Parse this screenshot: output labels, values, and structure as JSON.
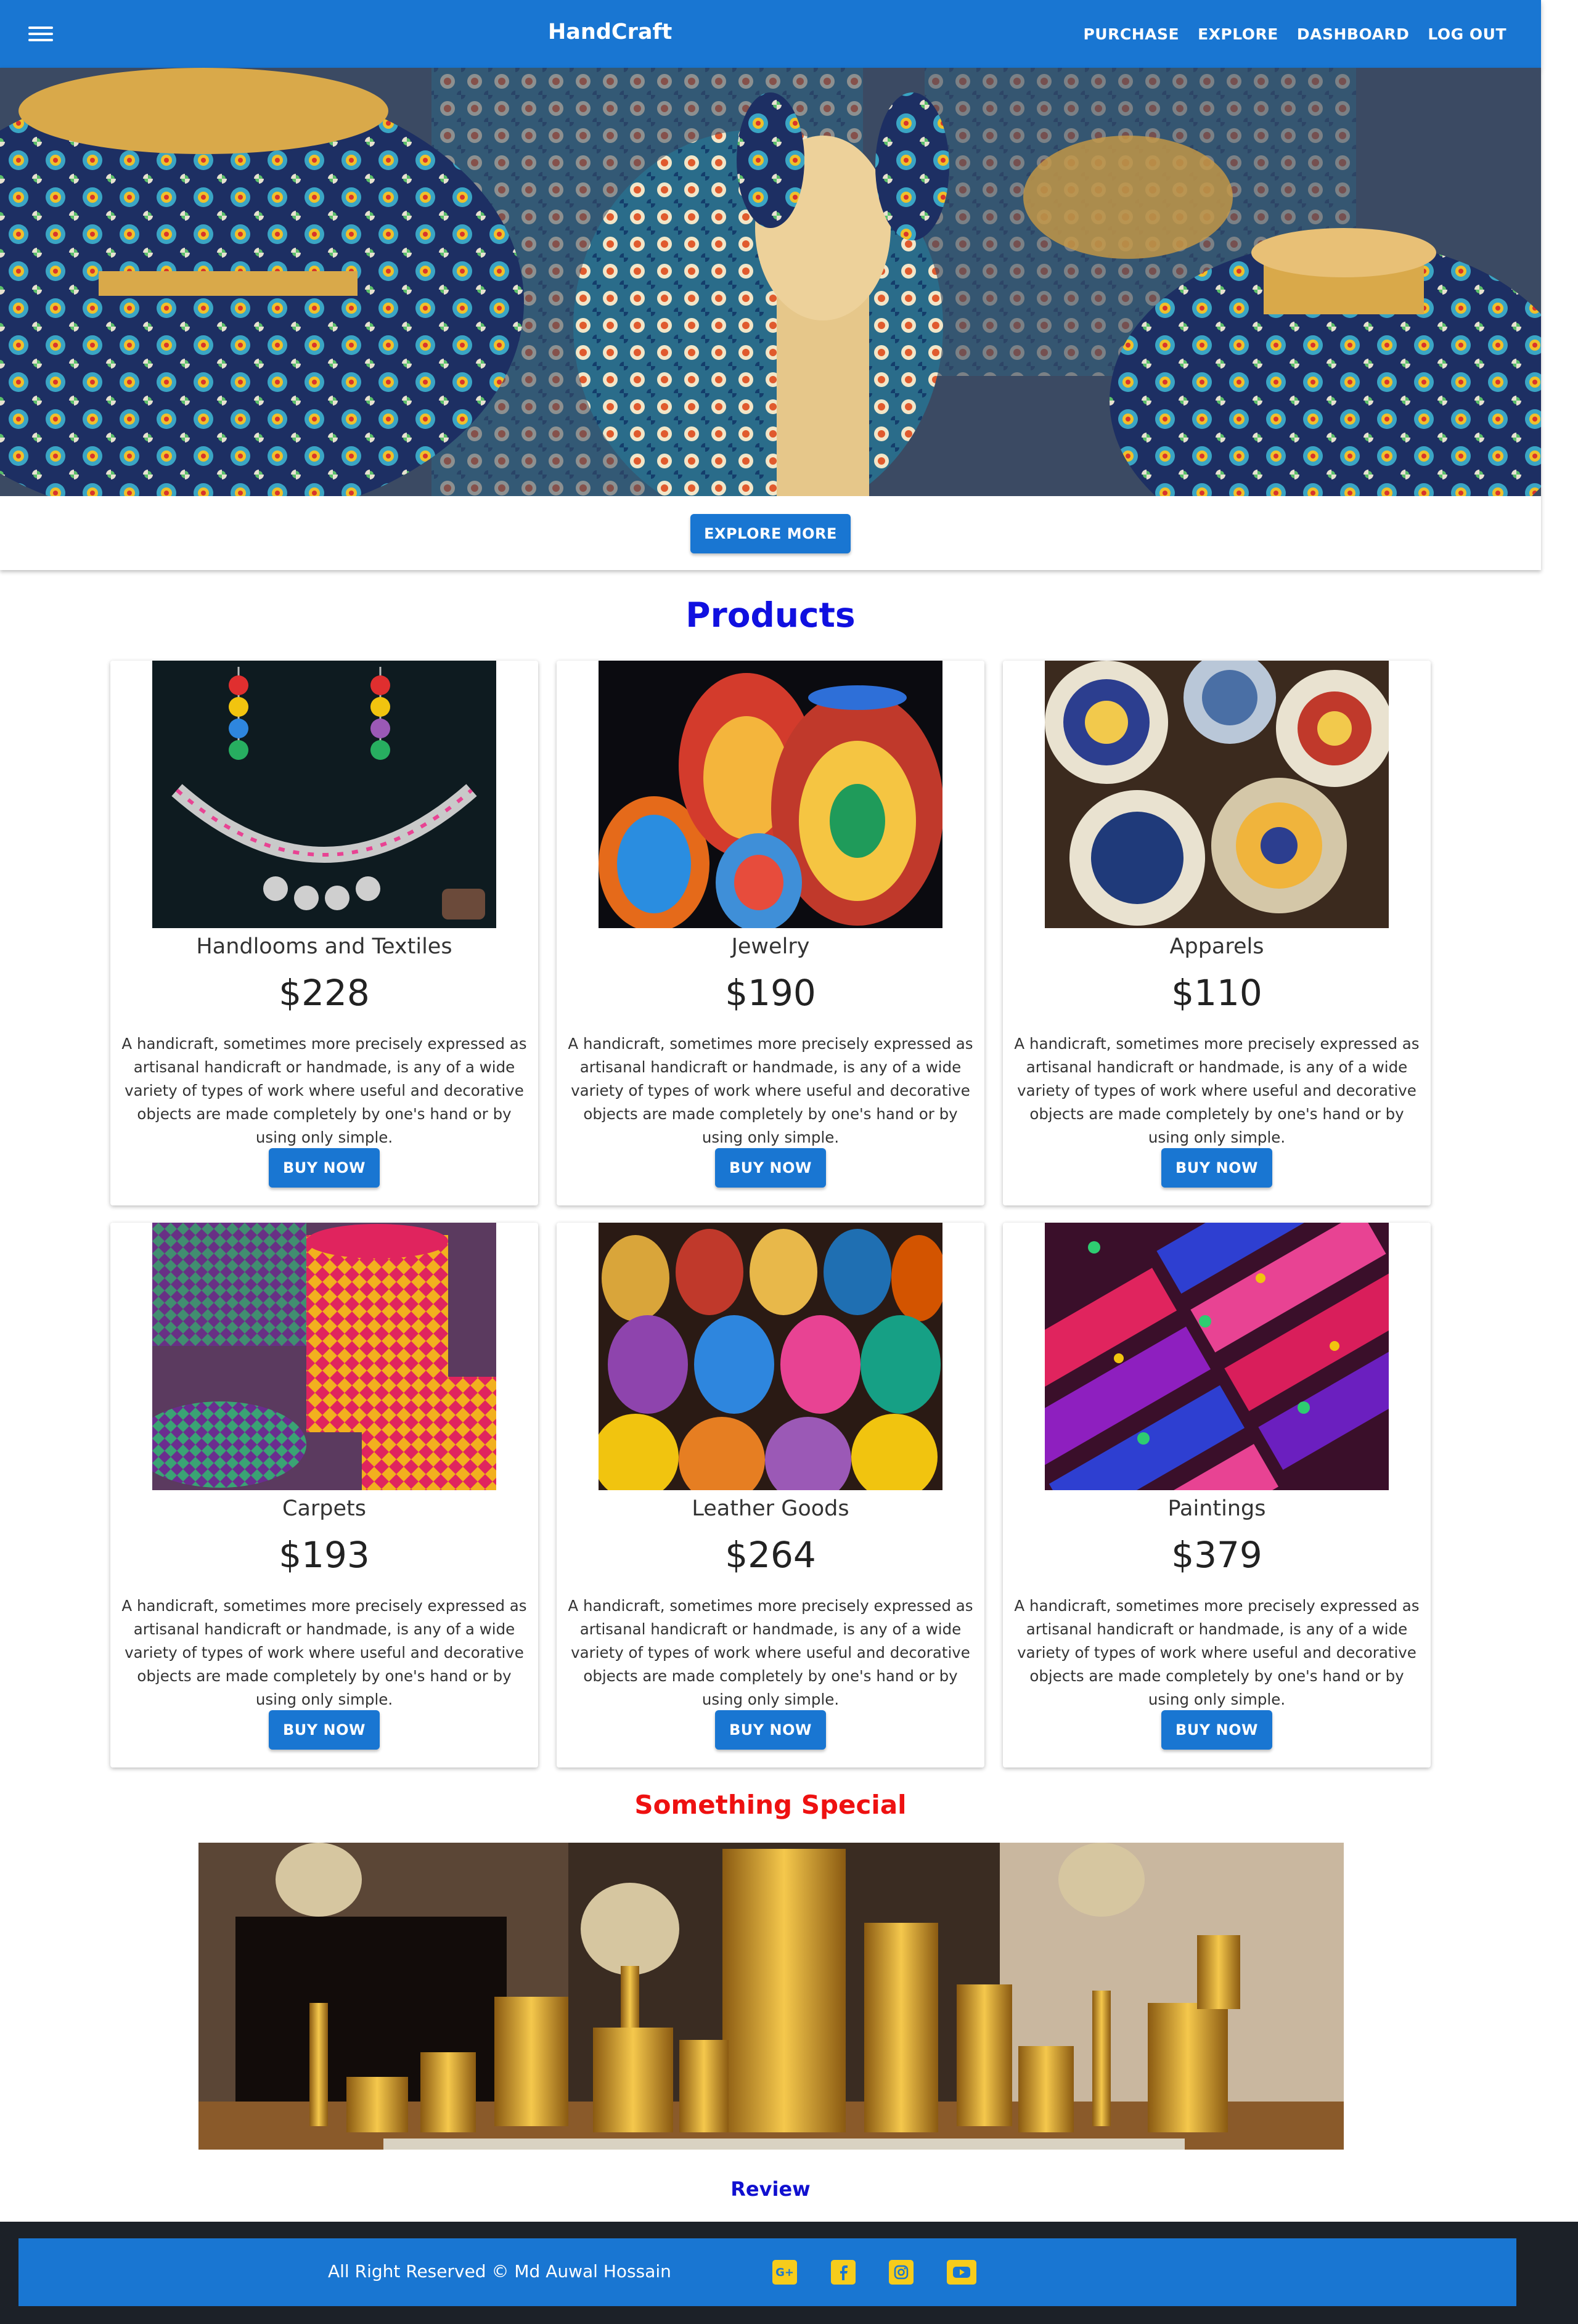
{
  "header": {
    "brand": "HandCraft",
    "nav": [
      "PURCHASE",
      "EXPLORE",
      "DASHBOARD",
      "LOG OUT"
    ]
  },
  "hero": {
    "button_label": "EXPLORE MORE"
  },
  "products": {
    "title": "Products",
    "buy_label": "BUY NOW",
    "items": [
      {
        "name": "Handlooms and Textiles",
        "price": "$228",
        "description": "A handicraft, sometimes more precisely expressed as artisanal handicraft or handmade, is any of a wide variety of types of work where useful and decorative objects are made completely by one's hand or by using only simple."
      },
      {
        "name": "Jewelry",
        "price": "$190",
        "description": "A handicraft, sometimes more precisely expressed as artisanal handicraft or handmade, is any of a wide variety of types of work where useful and decorative objects are made completely by one's hand or by using only simple."
      },
      {
        "name": "Apparels",
        "price": "$110",
        "description": "A handicraft, sometimes more precisely expressed as artisanal handicraft or handmade, is any of a wide variety of types of work where useful and decorative objects are made completely by one's hand or by using only simple."
      },
      {
        "name": "Carpets",
        "price": "$193",
        "description": "A handicraft, sometimes more precisely expressed as artisanal handicraft or handmade, is any of a wide variety of types of work where useful and decorative objects are made completely by one's hand or by using only simple."
      },
      {
        "name": "Leather Goods",
        "price": "$264",
        "description": "A handicraft, sometimes more precisely expressed as artisanal handicraft or handmade, is any of a wide variety of types of work where useful and decorative objects are made completely by one's hand or by using only simple."
      },
      {
        "name": "Paintings",
        "price": "$379",
        "description": "A handicraft, sometimes more precisely expressed as artisanal handicraft or handmade, is any of a wide variety of types of work where useful and decorative objects are made completely by one's hand or by using only simple."
      }
    ]
  },
  "special": {
    "title": "Something Special",
    "review_label": "Review"
  },
  "footer": {
    "copyright": "All Right Reserved © Md Auwal Hossain",
    "social_icons": [
      "google-plus-icon",
      "facebook-icon",
      "instagram-icon",
      "youtube-icon"
    ]
  },
  "colors": {
    "primary": "#1976d2",
    "products_title": "#1010e0",
    "special_title": "#ee1111",
    "social_icon": "#f6cc1b",
    "footer_bg": "#1c2128"
  }
}
